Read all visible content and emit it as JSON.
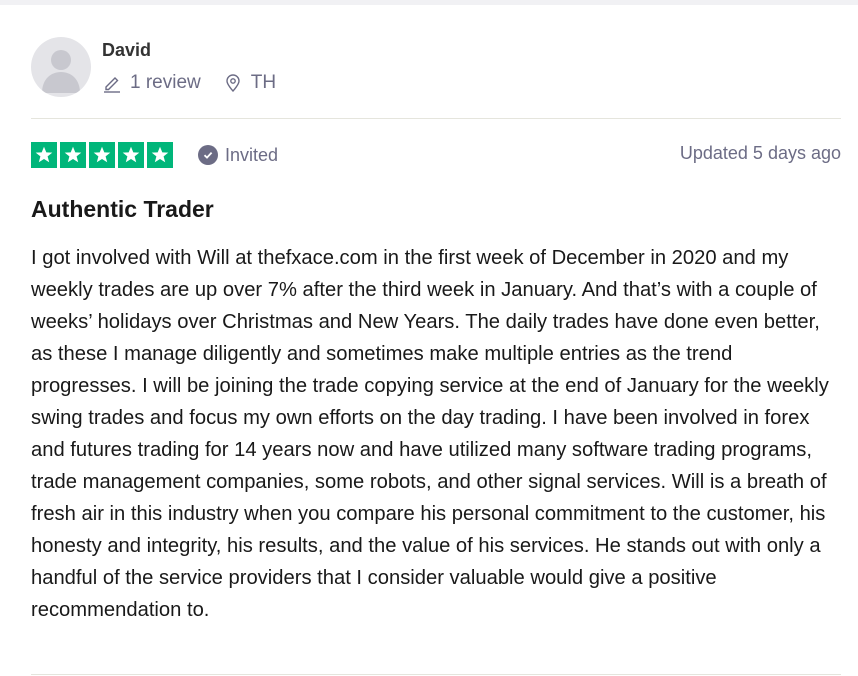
{
  "reviewer": {
    "name": "David",
    "review_count": "1 review",
    "country": "TH",
    "avatar_icon": "user-silhouette-icon"
  },
  "review": {
    "rating": 5,
    "rating_max": 5,
    "star_color": "#00b67a",
    "invited_label": "Invited",
    "updated_label": "Updated 5 days ago",
    "title": "Authentic Trader",
    "body": "I got involved with Will at thefxace.com in the first week of December in 2020 and my weekly trades are up over 7% after the third week in January. And that’s with a couple of weeks’ holidays over Christmas and New Years. The daily trades have done even better, as these I manage diligently and sometimes make multiple entries as the trend progresses. I will be joining the trade copying service at the end of January for the weekly swing trades and focus my own efforts on the day trading. I have been involved in forex and futures trading for 14 years now and have utilized many software trading programs, trade management companies, some robots, and other signal services. Will is a breath of fresh air in this industry when you compare his personal commitment to the customer, his honesty and integrity, his results, and the value of his services. He stands out with only a handful of the service providers that I consider valuable would give a positive recommendation to."
  }
}
